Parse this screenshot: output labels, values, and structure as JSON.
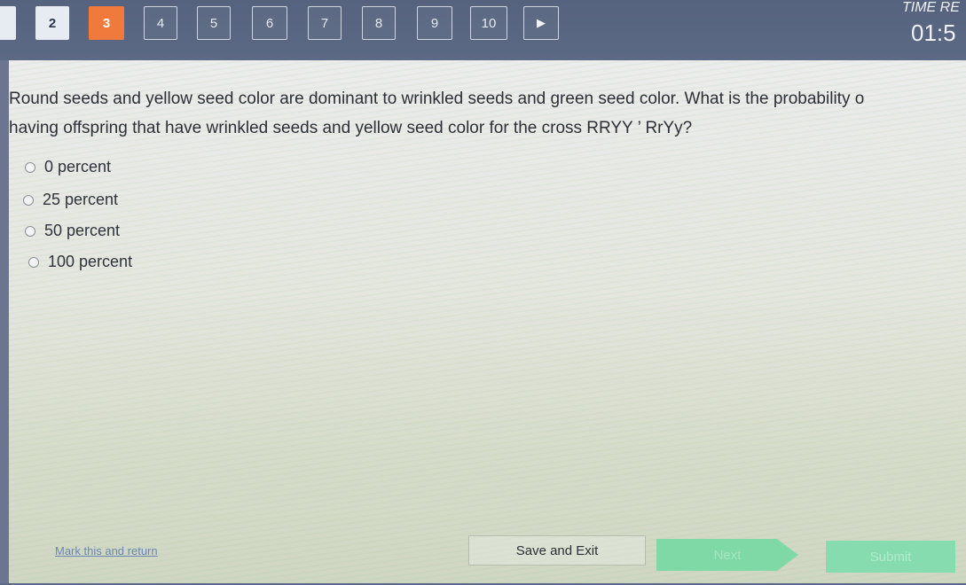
{
  "nav": {
    "questions": [
      {
        "label": "",
        "state": "answered"
      },
      {
        "label": "2",
        "state": "answered"
      },
      {
        "label": "3",
        "state": "current"
      },
      {
        "label": "4",
        "state": "unanswered"
      },
      {
        "label": "5",
        "state": "unanswered"
      },
      {
        "label": "6",
        "state": "unanswered"
      },
      {
        "label": "7",
        "state": "unanswered"
      },
      {
        "label": "8",
        "state": "unanswered"
      },
      {
        "label": "9",
        "state": "unanswered"
      },
      {
        "label": "10",
        "state": "unanswered"
      }
    ],
    "next_arrow": "▶"
  },
  "timer": {
    "label": "TIME RE",
    "value": "01:5"
  },
  "question": {
    "line1": "Round seeds and yellow seed color are dominant to wrinkled seeds and green seed color. What is the probability o",
    "line2": "having offspring that have wrinkled seeds and yellow seed color for the cross RRYY ’ RrYy?"
  },
  "options": [
    {
      "label": "0 percent"
    },
    {
      "label": "25 percent"
    },
    {
      "label": "50 percent"
    },
    {
      "label": "100 percent"
    }
  ],
  "footer": {
    "mark_label": "Mark this and return",
    "save_label": "Save and Exit",
    "next_label": "Next",
    "submit_label": "Submit"
  },
  "colors": {
    "current_question": "#ef7a3c",
    "next_button": "#7fd9a7",
    "submit_button": "#86dcaf"
  }
}
